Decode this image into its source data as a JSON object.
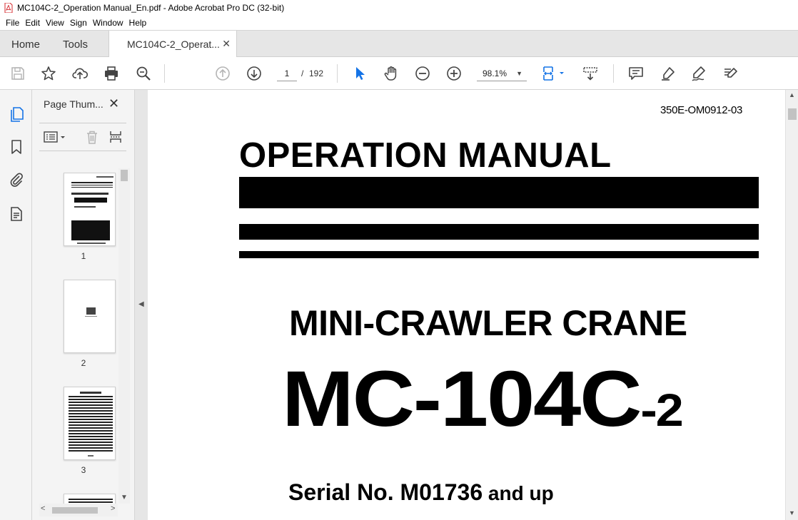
{
  "window": {
    "title": "MC104C-2_Operation Manual_En.pdf - Adobe Acrobat Pro DC (32-bit)"
  },
  "menu": {
    "items": [
      "File",
      "Edit",
      "View",
      "Sign",
      "Window",
      "Help"
    ]
  },
  "tabs": {
    "home": "Home",
    "tools": "Tools",
    "document": "MC104C-2_Operat...",
    "close_glyph": "✕"
  },
  "toolbar": {
    "current_page": "1",
    "page_separator": "/",
    "total_pages": "192",
    "zoom": "98.1%",
    "zoom_caret": "▼",
    "icons": [
      "save-icon",
      "star-icon",
      "upload-icon",
      "print-icon",
      "search-zoom-icon",
      "page-up-icon",
      "page-down-icon",
      "select-cursor-icon",
      "hand-icon",
      "zoom-out-icon",
      "zoom-in-icon",
      "fit-page-icon",
      "scroll-mode-icon",
      "comment-icon",
      "highlight-icon",
      "sign-icon",
      "fill-sign-icon"
    ],
    "accent_color": "#1473e6"
  },
  "left_rail": {
    "icons": [
      "pages-icon",
      "bookmark-icon",
      "attachment-icon",
      "document-properties-icon"
    ]
  },
  "thumb_panel": {
    "title": "Page Thum...",
    "close_glyph": "✕",
    "pages": [
      {
        "label": "1"
      },
      {
        "label": "2"
      },
      {
        "label": "3"
      }
    ],
    "scroll_up": "▲",
    "scroll_down": "▼",
    "scroll_left": "<",
    "scroll_right": ">"
  },
  "collapse_arrow": "◀",
  "document": {
    "code": "350E-OM0912-03",
    "heading": "OPERATION MANUAL",
    "subtitle": "MINI-CRAWLER CRANE",
    "model": "MC-104C",
    "model_suffix": "-2",
    "serial": "Serial No. M01736",
    "serial_suffix": " and up"
  },
  "right_scroll": {
    "up": "▲",
    "down": "▼"
  }
}
